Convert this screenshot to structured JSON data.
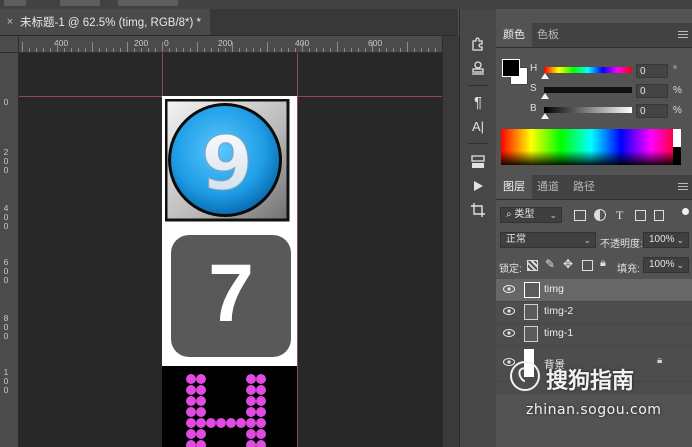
{
  "document_tab": {
    "close_glyph": "×",
    "title": "未标题-1 @ 62.5% (timg, RGB/8*) *"
  },
  "rulers": {
    "h_labels": [
      "400",
      "200",
      "0",
      "200",
      "400",
      "600"
    ],
    "v_labels": [
      "0",
      "2\n0\n0",
      "4\n0\n0",
      "6\n0\n0",
      "8\n0\n0",
      "1\n0\n0"
    ]
  },
  "canvas": {
    "numbers": [
      "9",
      "7"
    ],
    "colors": {
      "blue": "#1e9de6",
      "gray_tile": "#595959",
      "magenta": "#e04ae0",
      "black": "#000000"
    }
  },
  "tools": [
    {
      "icon": "puzzle-icon"
    },
    {
      "icon": "stamp-icon"
    },
    {
      "icon": "paragraph-icon",
      "glyph": "¶"
    },
    {
      "icon": "type-a-icon",
      "glyph": "A|"
    },
    {
      "icon": "layer-comps-icon"
    },
    {
      "icon": "play-icon"
    },
    {
      "icon": "crop-icon"
    }
  ],
  "color_panel": {
    "tabs": [
      "颜色",
      "色板"
    ],
    "sliders": [
      {
        "label": "H",
        "value": "0",
        "unit": "°"
      },
      {
        "label": "S",
        "value": "0",
        "unit": "%"
      },
      {
        "label": "B",
        "value": "0",
        "unit": "%"
      }
    ]
  },
  "layers_panel": {
    "tabs": [
      "图层",
      "通道",
      "路径"
    ],
    "filter_kind": "类型",
    "filter_icons": [
      "T"
    ],
    "blend_mode": "正常",
    "opacity_label": "不透明度:",
    "opacity_value": "100%",
    "lock_label": "锁定:",
    "fill_label": "填充:",
    "fill_value": "100%",
    "layers": [
      {
        "name": "timg",
        "selected": true
      },
      {
        "name": "timg-2",
        "selected": false
      },
      {
        "name": "timg-1",
        "selected": false
      },
      {
        "name": "背景",
        "selected": false
      }
    ]
  },
  "watermark": {
    "brand": "搜狗指南",
    "url": "zhinan.sogou.com"
  }
}
